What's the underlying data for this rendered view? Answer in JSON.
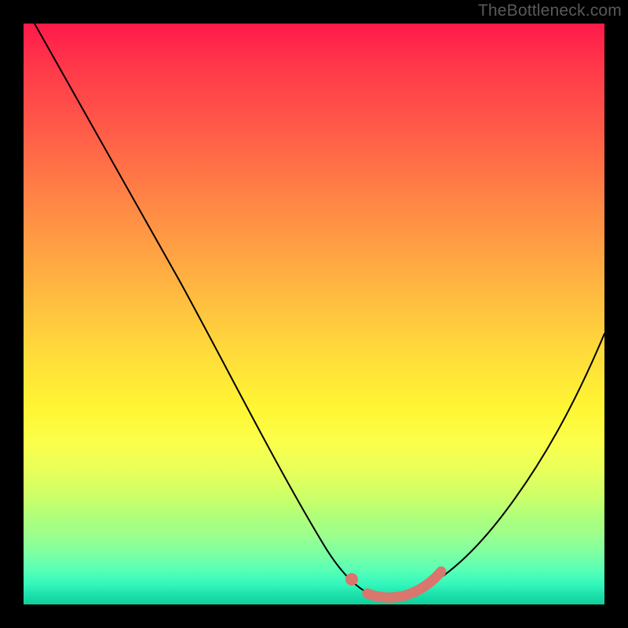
{
  "watermark": "TheBottleneck.com",
  "chart_data": {
    "type": "line",
    "title": "",
    "xlabel": "",
    "ylabel": "",
    "xlim": [
      0,
      100
    ],
    "ylim": [
      0,
      100
    ],
    "grid": false,
    "legend": false,
    "background": "rainbow-vertical-gradient",
    "series": [
      {
        "name": "bottleneck-curve",
        "color": "#000000",
        "x": [
          2,
          10,
          20,
          30,
          40,
          48,
          54,
          58,
          62,
          66,
          70,
          76,
          82,
          88,
          94,
          100
        ],
        "y": [
          100,
          87,
          71,
          55,
          38,
          23,
          12,
          6,
          2,
          0,
          0,
          3,
          10,
          21,
          34,
          48
        ]
      }
    ],
    "highlight": {
      "description": "optimal-range-marker",
      "color": "#d9766d",
      "dot": {
        "x": 57,
        "y": 4
      },
      "segment_x": [
        60,
        64,
        68,
        72
      ],
      "segment_y": [
        1,
        0,
        0,
        3
      ]
    }
  }
}
